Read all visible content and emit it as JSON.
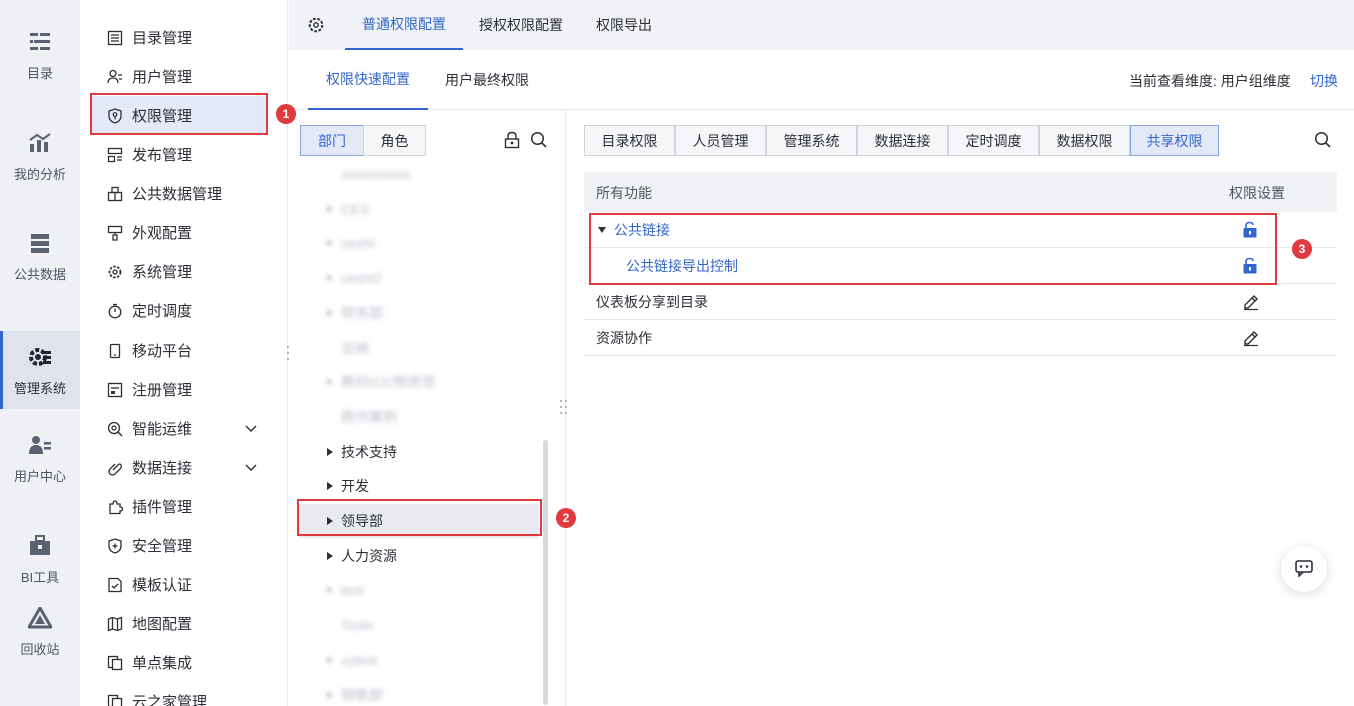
{
  "rail": {
    "items": [
      {
        "label": "目录",
        "icon": "catalog-icon"
      },
      {
        "label": "我的分析",
        "icon": "analysis-icon"
      },
      {
        "label": "公共数据",
        "icon": "database-icon"
      },
      {
        "label": "管理系统",
        "icon": "gear-manage-icon",
        "active": true
      },
      {
        "label": "用户中心",
        "icon": "user-center-icon"
      },
      {
        "label": "BI工具",
        "icon": "toolbox-icon"
      },
      {
        "label": "回收站",
        "icon": "recycle-icon"
      }
    ]
  },
  "nav": {
    "items": [
      {
        "label": "目录管理",
        "icon": "list-icon"
      },
      {
        "label": "用户管理",
        "icon": "user-list-icon"
      },
      {
        "label": "权限管理",
        "icon": "shield-key-icon",
        "active": true
      },
      {
        "label": "发布管理",
        "icon": "publish-icon"
      },
      {
        "label": "公共数据管理",
        "icon": "public-data-icon"
      },
      {
        "label": "外观配置",
        "icon": "brush-icon"
      },
      {
        "label": "系统管理",
        "icon": "settings-icon"
      },
      {
        "label": "定时调度",
        "icon": "timer-icon"
      },
      {
        "label": "移动平台",
        "icon": "mobile-icon"
      },
      {
        "label": "注册管理",
        "icon": "register-icon"
      },
      {
        "label": "智能运维",
        "icon": "smart-ops-icon",
        "expandable": true
      },
      {
        "label": "数据连接",
        "icon": "link-icon",
        "expandable": true
      },
      {
        "label": "插件管理",
        "icon": "plugin-icon"
      },
      {
        "label": "安全管理",
        "icon": "security-icon"
      },
      {
        "label": "模板认证",
        "icon": "template-icon"
      },
      {
        "label": "地图配置",
        "icon": "map-icon"
      },
      {
        "label": "单点集成",
        "icon": "sso-icon"
      },
      {
        "label": "云之家管理",
        "icon": "cloud-icon"
      }
    ]
  },
  "top_tabs": [
    "普通权限配置",
    "授权权限配置",
    "权限导出"
  ],
  "sub_tabs": [
    "权限快速配置",
    "用户最终权限"
  ],
  "dimension": {
    "text": "当前查看维度: 用户组维度",
    "switch_label": "切换"
  },
  "tree": {
    "segments": [
      "部门",
      "角色"
    ],
    "rows": [
      {
        "label": "xxxxxxxxxx",
        "blur": true,
        "arrow": false
      },
      {
        "label": "CES",
        "blur": true,
        "arrow": true
      },
      {
        "label": "cesht",
        "blur": true,
        "arrow": true
      },
      {
        "label": "cesht2",
        "blur": true,
        "arrow": true
      },
      {
        "label": "财务部",
        "blur": true,
        "arrow": true
      },
      {
        "label": "出纳",
        "blur": true,
        "arrow": false
      },
      {
        "label": "教材ICC物资项",
        "blur": true,
        "arrow": true
      },
      {
        "label": "图书案例",
        "blur": true,
        "arrow": false
      },
      {
        "label": "技术支持",
        "blur": false,
        "arrow": true
      },
      {
        "label": "开发",
        "blur": false,
        "arrow": true
      },
      {
        "label": "领导部",
        "blur": false,
        "arrow": true,
        "selected": true
      },
      {
        "label": "人力资源",
        "blur": false,
        "arrow": true
      },
      {
        "label": "test",
        "blur": true,
        "arrow": true
      },
      {
        "label": "Toolx",
        "blur": true,
        "arrow": false
      },
      {
        "label": "xytest",
        "blur": true,
        "arrow": true
      },
      {
        "label": "销售部",
        "blur": true,
        "arrow": true
      }
    ]
  },
  "perm_tabs": [
    "目录权限",
    "人员管理",
    "管理系统",
    "数据连接",
    "定时调度",
    "数据权限",
    "共享权限"
  ],
  "active_perm_tab": "共享权限",
  "table": {
    "headers": [
      "所有功能",
      "权限设置"
    ],
    "rows": [
      {
        "label": "公共链接",
        "perm_icon": "unlock-icon"
      },
      {
        "label": "公共链接导出控制",
        "perm_icon": "unlock-icon"
      },
      {
        "label": "仪表板分享到目录",
        "perm_icon": "edit-icon"
      },
      {
        "label": "资源协作",
        "perm_icon": "edit-icon"
      }
    ]
  },
  "badges": [
    "1",
    "2",
    "3"
  ],
  "colors": {
    "accent": "#3366cc",
    "annotation": "#e0393e",
    "active_bg": "#e3e9f7"
  }
}
